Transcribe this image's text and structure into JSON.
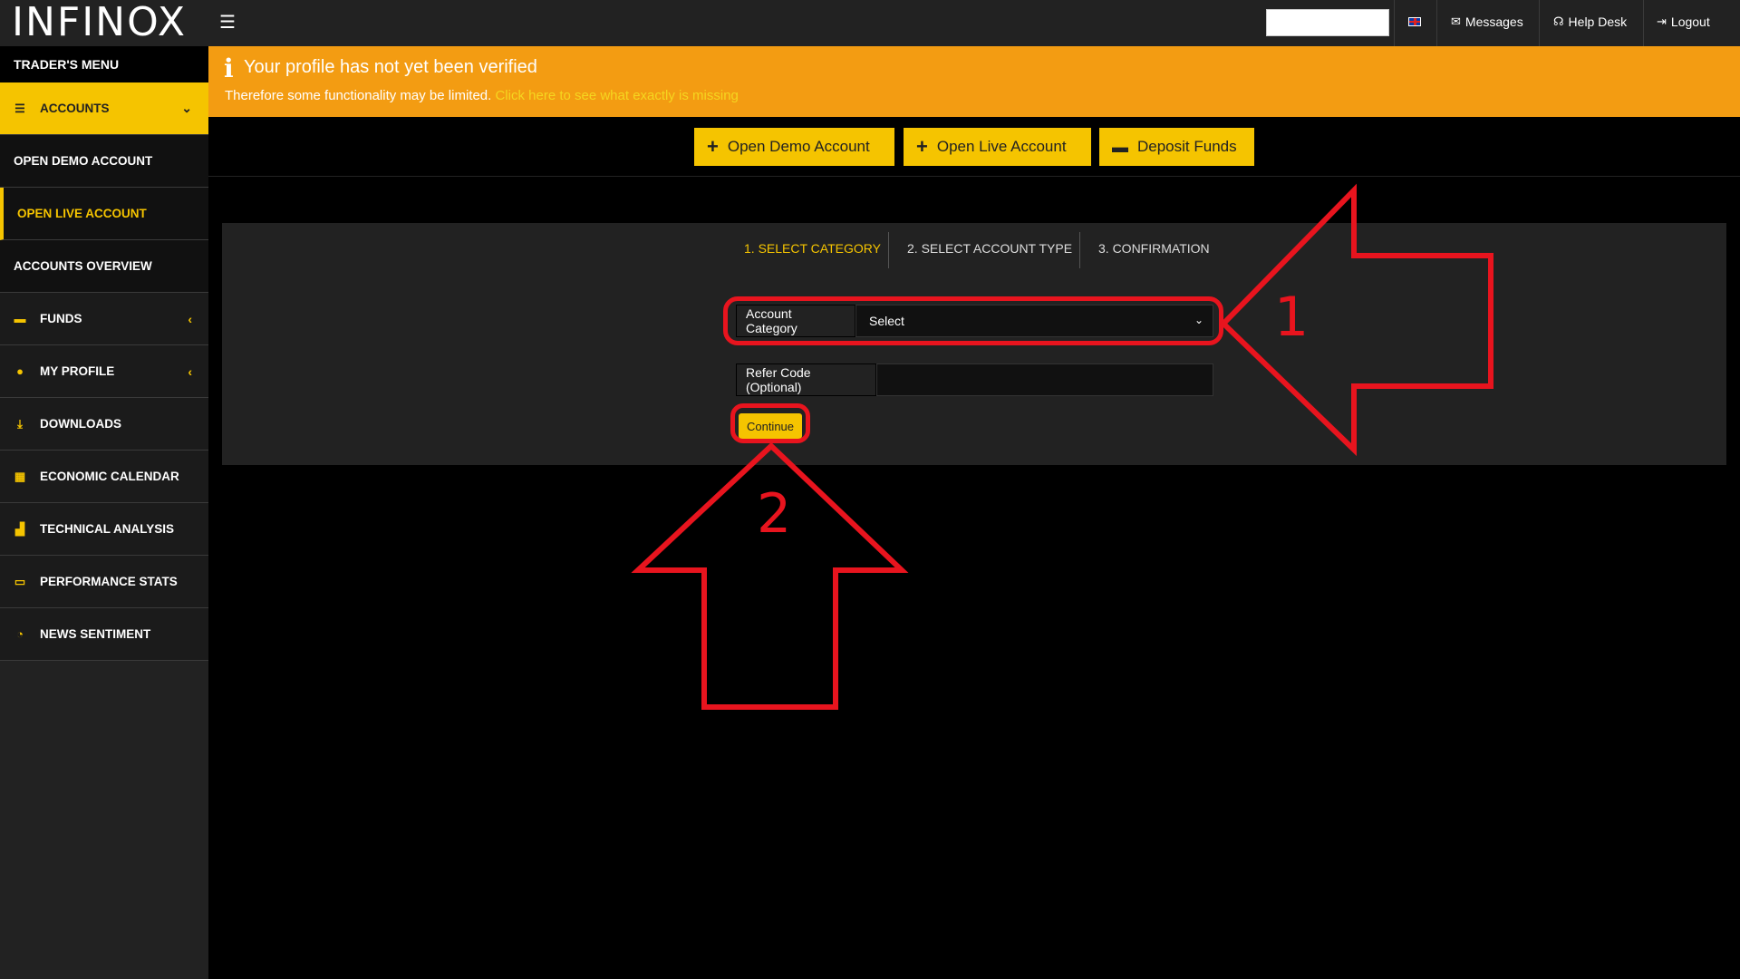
{
  "brand": {
    "logo_text": "INFINOX"
  },
  "topbar": {
    "messages_label": "Messages",
    "helpdesk_label": "Help Desk",
    "logout_label": "Logout",
    "search_placeholder": ""
  },
  "sidebar": {
    "header": "TRADER'S MENU",
    "items": [
      {
        "label": "ACCOUNTS",
        "icon": "list-icon",
        "active": true,
        "chevron": "down"
      },
      {
        "label": "OPEN DEMO ACCOUNT",
        "sub": true
      },
      {
        "label": "OPEN LIVE ACCOUNT",
        "sub": true,
        "current": true
      },
      {
        "label": "ACCOUNTS OVERVIEW",
        "sub": true
      },
      {
        "label": "FUNDS",
        "icon": "wallet-icon",
        "chevron": "left"
      },
      {
        "label": "MY PROFILE",
        "icon": "user-icon",
        "chevron": "left"
      },
      {
        "label": "DOWNLOADS",
        "icon": "download-icon"
      },
      {
        "label": "ECONOMIC CALENDAR",
        "icon": "calendar-icon"
      },
      {
        "label": "TECHNICAL ANALYSIS",
        "icon": "bar-chart-icon"
      },
      {
        "label": "PERFORMANCE STATS",
        "icon": "card-icon"
      },
      {
        "label": "NEWS SENTIMENT",
        "icon": "gauge-icon"
      }
    ]
  },
  "banner": {
    "title": "Your profile has not yet been verified",
    "message": "Therefore some functionality may be limited.",
    "link": "Click here to see what exactly is missing",
    "color": "#f39c12"
  },
  "actions": {
    "open_demo": "Open Demo Account",
    "open_live": "Open Live Account",
    "deposit": "Deposit Funds"
  },
  "wizard": {
    "steps": [
      "1.  SELECT CATEGORY",
      "2. SELECT ACCOUNT TYPE",
      "3. CONFIRMATION"
    ],
    "active_step": 0,
    "account_category_label": "Account Category",
    "account_category_value": "Select",
    "refer_code_label": "Refer Code (Optional)",
    "refer_code_value": "",
    "continue_label": "Continue"
  },
  "annotations": {
    "arrow1_label": "1",
    "arrow2_label": "2",
    "color": "#e8141e"
  },
  "theme": {
    "accent": "#f5c400",
    "background": "#000000",
    "panel": "#222222"
  }
}
